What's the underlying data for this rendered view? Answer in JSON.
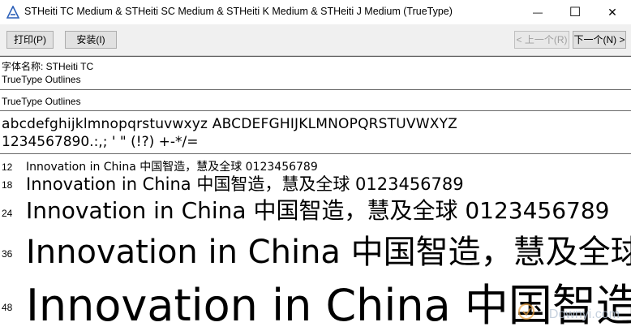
{
  "window": {
    "title": "STHeiti TC Medium & STHeiti SC Medium  & STHeiti K Medium  & STHeiti J Medium  (TrueType)",
    "minimize": "—",
    "maximize": "☐",
    "close": "✕"
  },
  "toolbar": {
    "print_label": "打印(P)",
    "install_label": "安装(I)",
    "prev_label": "< 上一个(R)",
    "next_label": "下一个(N) >"
  },
  "info": {
    "font_name": "字体名称: STHeiti TC",
    "outline_1": "TrueType Outlines",
    "outline_2": "TrueType Outlines"
  },
  "charset": {
    "line1": "abcdefghijklmnopqrstuvwxyz ABCDEFGHIJKLMNOPQRSTUVWXYZ",
    "line2": "1234567890.:,; ' \" (!?) +-*/="
  },
  "samples": [
    {
      "size": "12",
      "text": "Innovation in China 中国智造，慧及全球 0123456789"
    },
    {
      "size": "18",
      "text": "Innovation in China 中国智造，慧及全球 0123456789"
    },
    {
      "size": "24",
      "text": "Innovation in China 中国智造，慧及全球 0123456789"
    },
    {
      "size": "36",
      "text": "Innovation in China 中国智造，慧及全球"
    },
    {
      "size": "48",
      "text": "Innovation in China 中国智造"
    }
  ],
  "watermark": "Downyi.com",
  "colors": {
    "accent": "#2b5fb8",
    "disabled": "#a0a0a0"
  }
}
